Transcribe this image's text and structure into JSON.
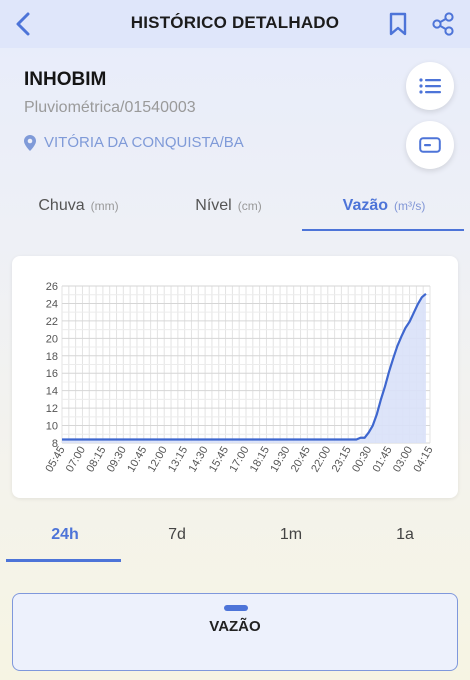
{
  "header": {
    "title": "HISTÓRICO DETALHADO"
  },
  "station": {
    "name": "INHOBIM",
    "code": "Pluviométrica/01540003",
    "location": "VITÓRIA DA CONQUISTA/BA"
  },
  "tabs": [
    {
      "label": "Chuva",
      "unit": "(mm)"
    },
    {
      "label": "Nível",
      "unit": "(cm)"
    },
    {
      "label": "Vazão",
      "unit": "(m³/s)"
    }
  ],
  "active_tab": 2,
  "periods": [
    "24h",
    "7d",
    "1m",
    "1a"
  ],
  "active_period": 0,
  "bottom_sheet": {
    "label": "VAZÃO"
  },
  "colors": {
    "accent": "#4d74d8",
    "line": "#3f67cf",
    "area_fill": "#d9e1f8"
  },
  "chart_data": {
    "type": "area",
    "x_ticks": [
      "05:45",
      "07:00",
      "08:15",
      "09:30",
      "10:45",
      "12:00",
      "13:15",
      "14:30",
      "15:45",
      "17:00",
      "18:15",
      "19:30",
      "20:45",
      "22:00",
      "23:15",
      "00:30",
      "01:45",
      "03:00",
      "04:15"
    ],
    "y_ticks": [
      8,
      10,
      12,
      14,
      16,
      18,
      20,
      22,
      24,
      26
    ],
    "ylim": [
      8,
      26
    ],
    "grid": true,
    "series": [
      {
        "points": [
          [
            "05:45",
            8.4
          ],
          [
            "07:00",
            8.4
          ],
          [
            "08:15",
            8.4
          ],
          [
            "09:30",
            8.4
          ],
          [
            "10:45",
            8.4
          ],
          [
            "12:00",
            8.4
          ],
          [
            "13:15",
            8.4
          ],
          [
            "14:30",
            8.4
          ],
          [
            "15:45",
            8.4
          ],
          [
            "17:00",
            8.4
          ],
          [
            "18:15",
            8.4
          ],
          [
            "19:30",
            8.4
          ],
          [
            "20:45",
            8.4
          ],
          [
            "22:00",
            8.4
          ],
          [
            "23:15",
            8.4
          ],
          [
            "23:45",
            8.4
          ],
          [
            "00:00",
            8.6
          ],
          [
            "00:15",
            8.6
          ],
          [
            "00:30",
            9.2
          ],
          [
            "00:45",
            10.0
          ],
          [
            "01:00",
            11.3
          ],
          [
            "01:15",
            13.0
          ],
          [
            "01:30",
            14.5
          ],
          [
            "01:45",
            16.2
          ],
          [
            "02:00",
            17.7
          ],
          [
            "02:15",
            19.1
          ],
          [
            "02:30",
            20.2
          ],
          [
            "02:45",
            21.2
          ],
          [
            "03:00",
            21.9
          ],
          [
            "03:15",
            22.9
          ],
          [
            "03:30",
            23.9
          ],
          [
            "03:45",
            24.7
          ],
          [
            "04:00",
            25.1
          ]
        ]
      }
    ]
  }
}
